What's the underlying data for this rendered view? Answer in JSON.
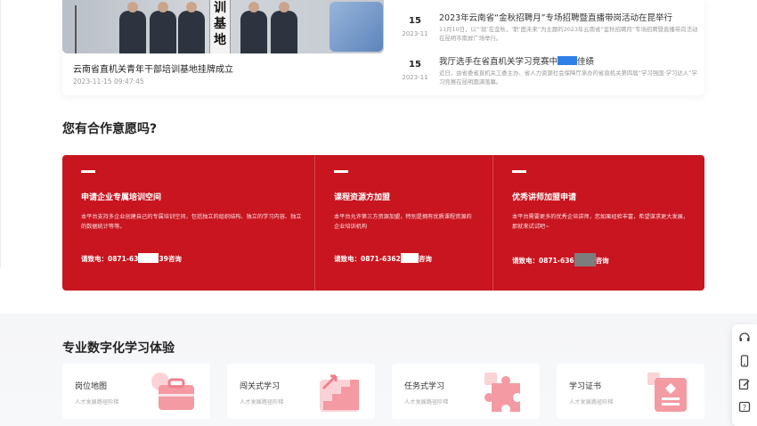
{
  "featured": {
    "title": "云南省直机关青年干部培训基地挂牌成立",
    "time": "2023-11-15 09:47:45",
    "board_chars": [
      "训",
      "基",
      "地"
    ]
  },
  "news": [
    {
      "day": "15",
      "ym": "2023-11",
      "title": "2023年云南省“金秋招聘月”专场招聘暨直播带岗活动在昆举行",
      "desc": "11月10日，以“‘就’在金秋，‘职’面未来”为主题的2023年云南省“金秋招聘月”专场招聘暨直播带岗活动在昆明市南屏广场举行。"
    },
    {
      "day": "15",
      "ym": "2023-11",
      "title_before": "我厅选手在省直机关学习竞赛中",
      "title_after": "佳绩",
      "desc": "近日，由省委省直机关工委主办、省人力资源社会保障厅承办的省直机关第四届“学习强国·学习达人”学习竞赛在昆明圆满落幕。"
    }
  ],
  "cooperation": {
    "heading": "您有合作意愿吗?",
    "columns": [
      {
        "title": "申请企业专属培训空间",
        "desc": "本平台支持多企业创建自己的专属培训空间，包括独立的组织结构、独立的学习内容、独立的数据统计等等。",
        "phone_before": "请致电：0871-63",
        "phone_after": "39咨询"
      },
      {
        "title": "课程资源方加盟",
        "desc": "本平台允许第三方资源加盟，特别是拥有优质课程资源的企业培训机构",
        "phone_before": "请致电：0871-6362",
        "phone_after": "咨询"
      },
      {
        "title": "优秀讲师加盟申请",
        "desc": "本平台需要更多的优秀企培讲师，您如果经验丰富，希望谋求更大发展，那就来试试吧~",
        "phone_before": "请致电：0871-636",
        "phone_after": "咨询"
      }
    ]
  },
  "learning": {
    "heading": "专业数字化学习体验",
    "cards": [
      {
        "title": "岗位地图",
        "sub": "人才发展路径阶梯",
        "icon": "toolbox-icon"
      },
      {
        "title": "闯关式学习",
        "sub": "人才发展路径阶梯",
        "icon": "stairs-icon"
      },
      {
        "title": "任务式学习",
        "sub": "人才发展路径阶梯",
        "icon": "puzzle-icon"
      },
      {
        "title": "学习证书",
        "sub": "人才发展路径阶梯",
        "icon": "certificate-icon"
      }
    ]
  },
  "toolbar": {
    "icons": [
      "headset-icon",
      "mobile-icon",
      "edit-icon",
      "help-icon"
    ]
  },
  "colors": {
    "brand_red": "#c8151f",
    "redaction_blue": "#2f7fe8",
    "card_pink": "#f6a9b0"
  }
}
